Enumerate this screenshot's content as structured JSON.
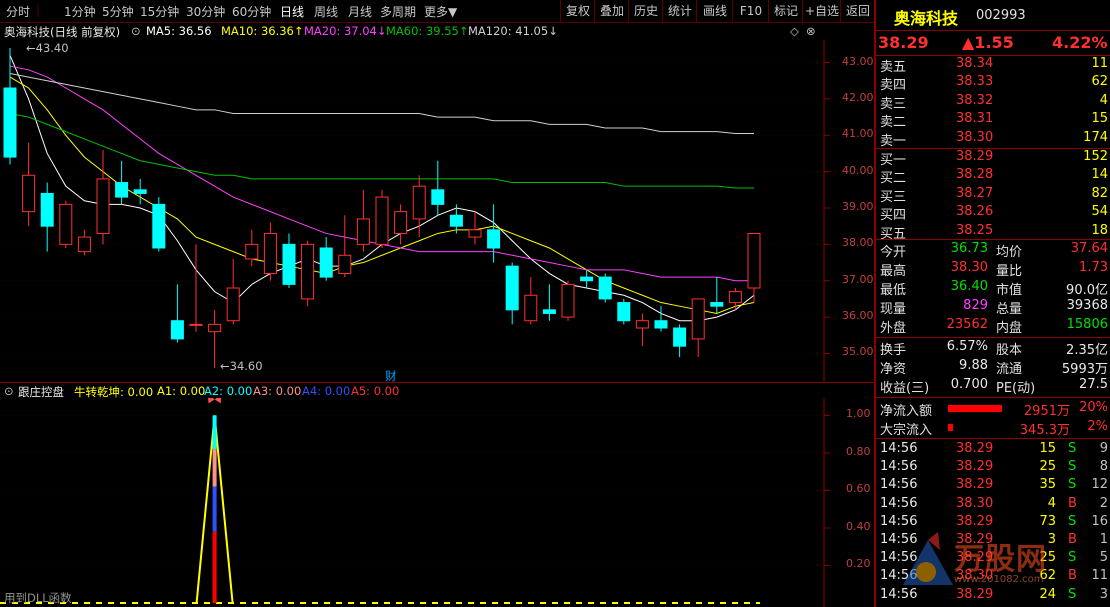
{
  "toolbar": {
    "periods": [
      "分时",
      "1分钟",
      "5分钟",
      "15分钟",
      "30分钟",
      "60分钟",
      "日线",
      "周线",
      "月线",
      "多周期",
      "更多▼"
    ],
    "active_index": 6,
    "actions": [
      "复权",
      "叠加",
      "历史",
      "统计",
      "画线",
      "F10",
      "标记",
      "+自选",
      "返回"
    ]
  },
  "chart_header": {
    "title": "奥海科技(日线 前复权)",
    "ma5": "MA5: 36.56",
    "ma10": "MA10: 36.36↑",
    "ma20": "MA20: 37.04↓",
    "ma60": "MA60: 39.55↑",
    "ma120": "MA120: 41.05↓",
    "high_mark": "43.40",
    "low_mark": "34.60",
    "cai_mark": "财",
    "price_ticks": [
      "43.00",
      "42.00",
      "41.00",
      "40.00",
      "39.00",
      "38.00",
      "37.00",
      "36.00",
      "35.00"
    ]
  },
  "indicator_header": {
    "name": "跟庄控盘",
    "nzqk": "牛转乾坤: 0.00",
    "a1": "A1: 0.00",
    "a2": "A2: 0.00",
    "a3": "A3: 0.00",
    "a4": "A4: 0.00",
    "a5": "A5: 0.00",
    "ticks": [
      "1.00",
      "0.80",
      "0.60",
      "0.40",
      "0.20"
    ],
    "bottom_note": "用到DLL函数"
  },
  "colors": {
    "up": "#ff3030",
    "down": "#00ffff",
    "ma5": "#ffffff",
    "ma10": "#ffff00",
    "ma20": "#ff40ff",
    "ma60": "#00c000",
    "ma120": "#d0d0d0",
    "border": "#8b0000"
  },
  "quote": {
    "name": "奥海科技",
    "code": "002993",
    "price": "38.29",
    "change": "▲1.55",
    "pct": "4.22%",
    "asks": [
      {
        "label": "卖五",
        "price": "38.34",
        "vol": "11"
      },
      {
        "label": "卖四",
        "price": "38.33",
        "vol": "62"
      },
      {
        "label": "卖三",
        "price": "38.32",
        "vol": "4"
      },
      {
        "label": "卖二",
        "price": "38.31",
        "vol": "15"
      },
      {
        "label": "卖一",
        "price": "38.30",
        "vol": "174"
      }
    ],
    "bids": [
      {
        "label": "买一",
        "price": "38.29",
        "vol": "152"
      },
      {
        "label": "买二",
        "price": "38.28",
        "vol": "14"
      },
      {
        "label": "买三",
        "price": "38.27",
        "vol": "82"
      },
      {
        "label": "买四",
        "price": "38.26",
        "vol": "54"
      },
      {
        "label": "买五",
        "price": "38.25",
        "vol": "18"
      }
    ],
    "stats": [
      {
        "l1": "今开",
        "v1": "36.73",
        "c1": "grn",
        "l2": "均价",
        "v2": "37.64",
        "c2": "red"
      },
      {
        "l1": "最高",
        "v1": "38.30",
        "c1": "red",
        "l2": "量比",
        "v2": "1.73",
        "c2": "red"
      },
      {
        "l1": "最低",
        "v1": "36.40",
        "c1": "grn",
        "l2": "市值",
        "v2": "90.0亿",
        "c2": "wht"
      },
      {
        "l1": "现量",
        "v1": "829",
        "c1": "mag",
        "l2": "总量",
        "v2": "39368",
        "c2": "wht"
      },
      {
        "l1": "外盘",
        "v1": "23562",
        "c1": "red",
        "l2": "内盘",
        "v2": "15806",
        "c2": "grn"
      }
    ],
    "stats2": [
      {
        "l1": "换手",
        "v1": "6.57%",
        "l2": "股本",
        "v2": "2.35亿"
      },
      {
        "l1": "净资",
        "v1": "9.88",
        "l2": "流通",
        "v2": "5993万"
      },
      {
        "l1": "收益(三)",
        "v1": "0.700",
        "l2": "PE(动)",
        "v2": "27.5"
      }
    ],
    "flow": [
      {
        "label": "净流入额",
        "value": "2951万",
        "pct": "20%",
        "bar": 1.0
      },
      {
        "label": "大宗流入",
        "value": "345.3万",
        "pct": "2%",
        "bar": 0.1
      }
    ],
    "ticks": [
      {
        "t": "14:56",
        "p": "38.29",
        "v": "15",
        "bs": "S",
        "n": "9"
      },
      {
        "t": "14:56",
        "p": "38.29",
        "v": "25",
        "bs": "S",
        "n": "8"
      },
      {
        "t": "14:56",
        "p": "38.29",
        "v": "35",
        "bs": "S",
        "n": "12"
      },
      {
        "t": "14:56",
        "p": "38.30",
        "v": "4",
        "bs": "B",
        "n": "2"
      },
      {
        "t": "14:56",
        "p": "38.29",
        "v": "73",
        "bs": "S",
        "n": "16"
      },
      {
        "t": "14:56",
        "p": "38.29",
        "v": "3",
        "bs": "B",
        "n": "1"
      },
      {
        "t": "14:56",
        "p": "38.29",
        "v": "25",
        "bs": "S",
        "n": "5"
      },
      {
        "t": "14:56",
        "p": "38.30",
        "v": "62",
        "bs": "B",
        "n": "11"
      },
      {
        "t": "14:56",
        "p": "38.29",
        "v": "24",
        "bs": "S",
        "n": "3"
      }
    ]
  },
  "watermark": {
    "title": "万股网",
    "url": "www.201082.com"
  },
  "chart_data": {
    "type": "candlestick",
    "ylim": [
      34.6,
      43.4
    ],
    "candles": [
      {
        "o": 42.3,
        "c": 40.4,
        "h": 43.4,
        "l": 40.2
      },
      {
        "o": 38.9,
        "c": 39.9,
        "h": 40.8,
        "l": 38.5
      },
      {
        "o": 39.4,
        "c": 38.5,
        "h": 39.7,
        "l": 37.8
      },
      {
        "o": 38.0,
        "c": 39.1,
        "h": 39.2,
        "l": 37.9
      },
      {
        "o": 37.8,
        "c": 38.2,
        "h": 38.4,
        "l": 37.7
      },
      {
        "o": 38.3,
        "c": 39.8,
        "h": 40.6,
        "l": 38.0
      },
      {
        "o": 39.7,
        "c": 39.3,
        "h": 40.3,
        "l": 39.1
      },
      {
        "o": 39.5,
        "c": 39.4,
        "h": 39.8,
        "l": 39.1
      },
      {
        "o": 39.1,
        "c": 37.9,
        "h": 39.3,
        "l": 37.8
      },
      {
        "o": 35.9,
        "c": 35.4,
        "h": 36.9,
        "l": 35.3
      },
      {
        "o": 35.8,
        "c": 35.8,
        "h": 38.0,
        "l": 35.6
      },
      {
        "o": 35.6,
        "c": 35.8,
        "h": 36.2,
        "l": 34.6
      },
      {
        "o": 35.9,
        "c": 36.8,
        "h": 37.6,
        "l": 35.8
      },
      {
        "o": 37.6,
        "c": 38.0,
        "h": 38.4,
        "l": 37.4
      },
      {
        "o": 37.2,
        "c": 38.3,
        "h": 38.6,
        "l": 37.0
      },
      {
        "o": 38.0,
        "c": 36.9,
        "h": 38.3,
        "l": 36.8
      },
      {
        "o": 36.5,
        "c": 38.0,
        "h": 38.1,
        "l": 36.3
      },
      {
        "o": 37.9,
        "c": 37.1,
        "h": 38.2,
        "l": 37.0
      },
      {
        "o": 37.2,
        "c": 37.7,
        "h": 38.8,
        "l": 37.1
      },
      {
        "o": 38.0,
        "c": 38.7,
        "h": 39.5,
        "l": 37.8
      },
      {
        "o": 38.0,
        "c": 39.3,
        "h": 39.5,
        "l": 37.9
      },
      {
        "o": 38.3,
        "c": 38.9,
        "h": 39.1,
        "l": 38.0
      },
      {
        "o": 38.7,
        "c": 39.6,
        "h": 39.9,
        "l": 38.2
      },
      {
        "o": 39.5,
        "c": 39.1,
        "h": 40.3,
        "l": 38.8
      },
      {
        "o": 38.8,
        "c": 38.5,
        "h": 39.1,
        "l": 38.3
      },
      {
        "o": 38.2,
        "c": 38.4,
        "h": 38.9,
        "l": 38.0
      },
      {
        "o": 38.4,
        "c": 37.9,
        "h": 39.1,
        "l": 37.5
      },
      {
        "o": 37.4,
        "c": 36.2,
        "h": 37.5,
        "l": 35.8
      },
      {
        "o": 35.9,
        "c": 36.6,
        "h": 37.1,
        "l": 35.8
      },
      {
        "o": 36.2,
        "c": 36.1,
        "h": 36.9,
        "l": 35.9
      },
      {
        "o": 36.0,
        "c": 36.9,
        "h": 37.0,
        "l": 35.9
      },
      {
        "o": 37.1,
        "c": 37.0,
        "h": 37.3,
        "l": 36.8
      },
      {
        "o": 37.1,
        "c": 36.5,
        "h": 37.2,
        "l": 36.4
      },
      {
        "o": 36.4,
        "c": 35.9,
        "h": 36.5,
        "l": 35.8
      },
      {
        "o": 35.7,
        "c": 35.9,
        "h": 36.1,
        "l": 35.2
      },
      {
        "o": 35.9,
        "c": 35.7,
        "h": 36.3,
        "l": 35.6
      },
      {
        "o": 35.7,
        "c": 35.2,
        "h": 35.8,
        "l": 34.9
      },
      {
        "o": 35.4,
        "c": 36.5,
        "h": 36.5,
        "l": 34.9
      },
      {
        "o": 36.4,
        "c": 36.3,
        "h": 37.1,
        "l": 36.1
      },
      {
        "o": 36.4,
        "c": 36.7,
        "h": 36.8,
        "l": 36.2
      },
      {
        "o": 36.8,
        "c": 38.3,
        "h": 38.3,
        "l": 36.4
      }
    ],
    "ma": [
      {
        "name": "MA5",
        "color": "#ffffff",
        "values": [
          43.2,
          42.0,
          40.5,
          39.6,
          39.2,
          39.1,
          39.1,
          39.0,
          38.8,
          38.1,
          37.3,
          36.7,
          36.4,
          36.9,
          37.2,
          37.4,
          37.6,
          37.4,
          37.4,
          37.6,
          38.0,
          38.3,
          38.5,
          38.8,
          39.0,
          38.9,
          38.6,
          38.1,
          37.6,
          37.2,
          36.9,
          36.8,
          36.7,
          36.6,
          36.4,
          36.1,
          35.9,
          35.9,
          36.0,
          36.2,
          36.6
        ]
      },
      {
        "name": "MA10",
        "color": "#ffff00",
        "values": [
          42.6,
          42.3,
          41.7,
          41.0,
          40.4,
          40.0,
          39.6,
          39.3,
          39.0,
          38.7,
          38.2,
          38.0,
          37.8,
          37.6,
          37.5,
          37.4,
          37.3,
          37.2,
          37.4,
          37.5,
          37.7,
          37.9,
          38.1,
          38.3,
          38.4,
          38.4,
          38.5,
          38.3,
          38.1,
          37.9,
          37.6,
          37.3,
          37.0,
          36.8,
          36.6,
          36.4,
          36.3,
          36.2,
          36.1,
          36.3,
          36.4
        ]
      },
      {
        "name": "MA20",
        "color": "#ff40ff",
        "values": [
          42.9,
          42.8,
          42.6,
          42.3,
          42.0,
          41.7,
          41.3,
          40.9,
          40.5,
          40.2,
          39.9,
          39.6,
          39.3,
          39.1,
          38.9,
          38.7,
          38.5,
          38.3,
          38.2,
          38.1,
          38.0,
          37.9,
          37.8,
          37.8,
          37.8,
          37.8,
          37.8,
          37.7,
          37.6,
          37.5,
          37.4,
          37.3,
          37.3,
          37.3,
          37.2,
          37.1,
          37.1,
          37.1,
          37.1,
          37.0,
          37.0
        ]
      },
      {
        "name": "MA60",
        "color": "#00c000",
        "values": [
          41.6,
          41.5,
          41.3,
          41.1,
          40.9,
          40.7,
          40.5,
          40.3,
          40.2,
          40.1,
          40.0,
          39.9,
          39.9,
          39.8,
          39.8,
          39.8,
          39.8,
          39.8,
          39.8,
          39.8,
          39.8,
          39.8,
          39.8,
          39.8,
          39.8,
          39.8,
          39.8,
          39.7,
          39.7,
          39.7,
          39.7,
          39.7,
          39.7,
          39.6,
          39.6,
          39.6,
          39.6,
          39.6,
          39.6,
          39.55,
          39.55
        ]
      },
      {
        "name": "MA120",
        "color": "#d0d0d0",
        "values": [
          42.7,
          42.6,
          42.5,
          42.4,
          42.3,
          42.2,
          42.1,
          42.0,
          41.9,
          41.8,
          41.7,
          41.7,
          41.6,
          41.6,
          41.6,
          41.6,
          41.6,
          41.6,
          41.6,
          41.6,
          41.6,
          41.6,
          41.6,
          41.5,
          41.5,
          41.5,
          41.4,
          41.4,
          41.4,
          41.3,
          41.3,
          41.3,
          41.2,
          41.2,
          41.2,
          41.1,
          41.1,
          41.1,
          41.1,
          41.05,
          41.05
        ]
      }
    ],
    "indicator": {
      "ylim": [
        0,
        1.05
      ],
      "spike_index": 11,
      "spike_value": 1.0
    }
  }
}
